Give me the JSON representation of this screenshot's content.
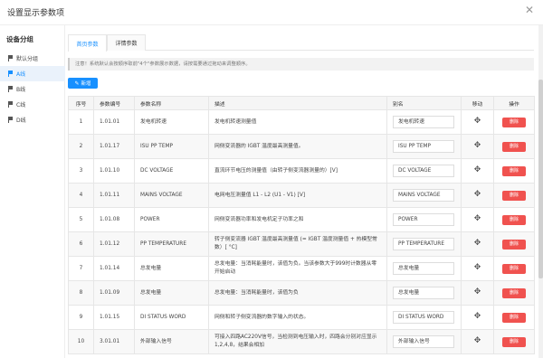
{
  "window": {
    "title": "设置显示参数项",
    "close_icon": "close-icon"
  },
  "sidebar": {
    "title": "设备分组",
    "items": [
      {
        "label": "默认分组",
        "active": false
      },
      {
        "label": "A线",
        "active": true
      },
      {
        "label": "B线",
        "active": false
      },
      {
        "label": "C线",
        "active": false
      },
      {
        "label": "D线",
        "active": false
      }
    ]
  },
  "tabs": [
    {
      "label": "首页参数",
      "active": true
    },
    {
      "label": "详情参数",
      "active": false
    }
  ],
  "notice": "注意！系统默认会按顺序取前\"4个\"参数展示数据，请按需要通过拖动来调整顺序。",
  "toolbar": {
    "add_label": "新增"
  },
  "table": {
    "headers": [
      "序号",
      "参数编号",
      "参数名称",
      "描述",
      "别名",
      "移动",
      "操作"
    ],
    "delete_label": "删除",
    "rows": [
      {
        "seq": "1",
        "code": "1.01.01",
        "name": "发电机转速",
        "desc": "发电机转速测量值",
        "alias": "发电机转速"
      },
      {
        "seq": "2",
        "code": "1.01.17",
        "name": "ISU PP TEMP",
        "desc": "网侧变流器的 IGBT 温度最高测量值。",
        "alias": "ISU PP TEMP"
      },
      {
        "seq": "3",
        "code": "1.01.10",
        "name": "DC VOLTAGE",
        "desc": "直流环节电压的测量值（由转子侧变流器测量的）[V]",
        "alias": "DC VOLTAGE"
      },
      {
        "seq": "4",
        "code": "1.01.11",
        "name": "MAINS VOLTAGE",
        "desc": "电网电压测量值 L1 - L2 (U1 - V1) [V]",
        "alias": "MAINS VOLTAGE"
      },
      {
        "seq": "5",
        "code": "1.01.08",
        "name": "POWER",
        "desc": "网侧变流器功率和发电机定子功率之和",
        "alias": "POWER"
      },
      {
        "seq": "6",
        "code": "1.01.12",
        "name": "PP TEMPERATURE",
        "desc": "转子侧变流器 IGBT 温度最高测量值 (= IGBT 温度测量值 + 热模型常数）[ °C]",
        "alias": "PP TEMPERATURE"
      },
      {
        "seq": "7",
        "code": "1.01.14",
        "name": "总发电量",
        "desc": "总发电量：当消耗能量时，该值为负。当该参数大于999时计数器从零开始启动",
        "alias": "总发电量"
      },
      {
        "seq": "8",
        "code": "1.01.09",
        "name": "总发电量",
        "desc": "总发电量：当消耗能量时，该值为负",
        "alias": "总发电量"
      },
      {
        "seq": "9",
        "code": "1.01.15",
        "name": "DI STATUS WORD",
        "desc": "网侧和转子侧变流器的数字输入的状态。",
        "alias": "DI STATUS WORD"
      },
      {
        "seq": "10",
        "code": "3.01.01",
        "name": "外部输入信号",
        "desc": "可接入四路AC220V信号，当检测到电压输入时，四路会分别对应显示1,2,4,8，结果会相加",
        "alias": "外部输入信号"
      }
    ]
  }
}
